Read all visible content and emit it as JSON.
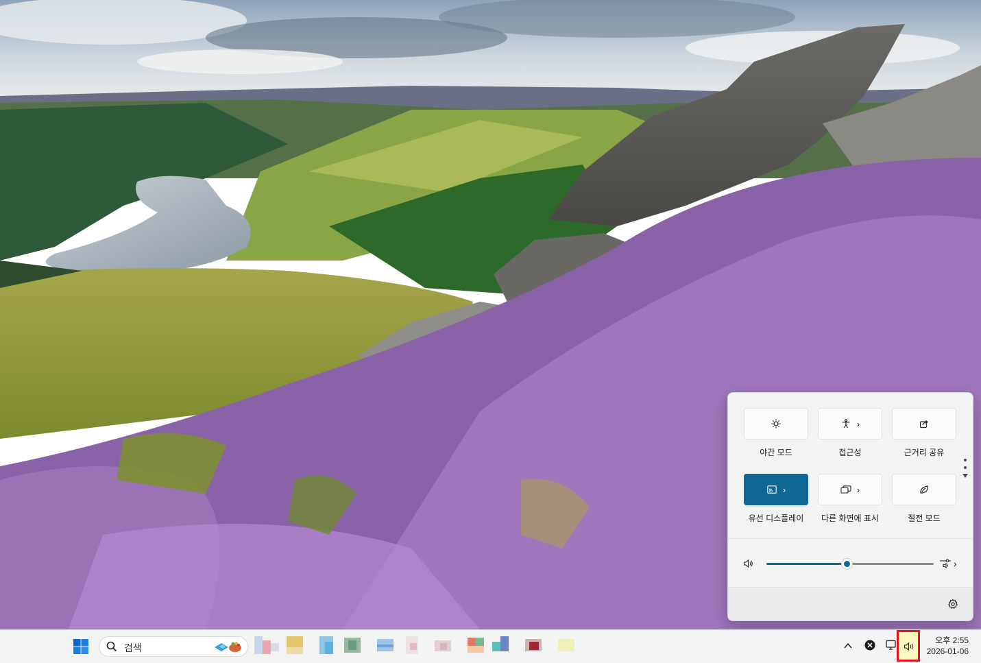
{
  "quick_settings": {
    "tiles": [
      {
        "label": "야간 모드",
        "icon": "night-light-icon",
        "active": false,
        "has_chevron": false
      },
      {
        "label": "접근성",
        "icon": "accessibility-icon",
        "active": false,
        "has_chevron": true
      },
      {
        "label": "근거리 공유",
        "icon": "nearby-share-icon",
        "active": false,
        "has_chevron": false
      },
      {
        "label": "유선 디스플레이",
        "icon": "cast-icon",
        "active": true,
        "has_chevron": true
      },
      {
        "label": "다른 화면에 표시",
        "icon": "project-icon",
        "active": false,
        "has_chevron": true
      },
      {
        "label": "절전 모드",
        "icon": "energy-saver-icon",
        "active": false,
        "has_chevron": false
      }
    ],
    "volume": {
      "level": 0.48,
      "icon": "speaker-icon",
      "output_icon": "sound-output-icon"
    },
    "settings_icon": "gear-icon"
  },
  "taskbar": {
    "start_icon": "windows-logo-icon",
    "search_placeholder": "검색",
    "apps": [
      "app-1",
      "app-2",
      "app-3",
      "app-4",
      "app-5",
      "app-6",
      "app-7",
      "app-8",
      "app-9",
      "app-10",
      "app-11",
      "app-12",
      "app-13"
    ],
    "tray": {
      "time": "오후 2:55",
      "date": "2026-01-06"
    }
  },
  "colors": {
    "accent": "#0f6794",
    "highlight_border": "#e8141d"
  }
}
